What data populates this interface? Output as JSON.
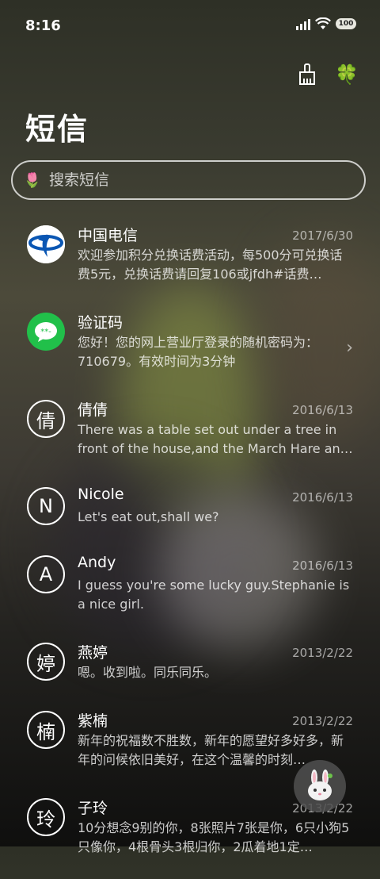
{
  "status_bar": {
    "time": "8:16",
    "battery": "100"
  },
  "page_title": "短信",
  "search": {
    "placeholder": "搜索短信"
  },
  "conversations": [
    {
      "name": "中国电信",
      "date": "2017/6/30",
      "preview": "欢迎参加积分兑换话费活动，每500分可兑换话费5元，兑换话费请回复106或jfdh#话费…"
    },
    {
      "name": "验证码",
      "date": "",
      "preview": "您好！您的网上营业厅登录的随机密码为：710679。有效时间为3分钟"
    },
    {
      "name": "倩倩",
      "avatar_letter": "倩",
      "date": "2016/6/13",
      "preview": "There was a table set out under a tree in front of the house,and the March Hare an…"
    },
    {
      "name": "Nicole",
      "avatar_letter": "N",
      "date": "2016/6/13",
      "preview": "Let's eat out,shall we?"
    },
    {
      "name": "Andy",
      "avatar_letter": "A",
      "date": "2016/6/13",
      "preview": "I guess you're some lucky guy.Stephanie is a nice girl."
    },
    {
      "name": "燕婷",
      "avatar_letter": "婷",
      "date": "2013/2/22",
      "preview": "嗯。收到啦。同乐同乐。"
    },
    {
      "name": "紫楠",
      "avatar_letter": "楠",
      "date": "2013/2/22",
      "preview": "新年的祝福数不胜数，新年的愿望好多好多，新年的问候依旧美好，在这个温馨的时刻…"
    },
    {
      "name": "子玲",
      "avatar_letter": "玲",
      "date": "2013/2/22",
      "preview": "10分想念9别的你，8张照片7张是你，6只小狗5只像你，4根骨头3根归你，2瓜着地1定…"
    }
  ],
  "icons": {
    "clean": "broom-icon",
    "theme": "clover-icon",
    "fab": "bunny-icon"
  }
}
